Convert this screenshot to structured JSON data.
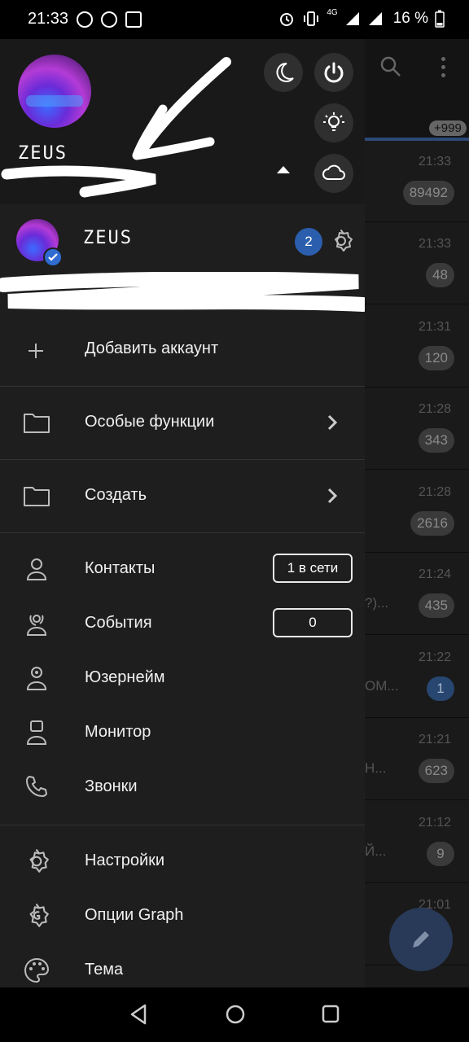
{
  "status_bar": {
    "time": "21:33",
    "network": "4G",
    "battery": "16 %"
  },
  "background_chats": {
    "badge_top": "+999",
    "rows": [
      {
        "time": "21:33",
        "count": "89492",
        "snippet": "",
        "blue": false
      },
      {
        "time": "21:33",
        "count": "48",
        "snippet": "",
        "blue": false
      },
      {
        "time": "21:31",
        "count": "120",
        "snippet": "",
        "blue": false
      },
      {
        "time": "21:28",
        "count": "343",
        "snippet": "",
        "blue": false
      },
      {
        "time": "21:28",
        "count": "2616",
        "snippet": "",
        "blue": false
      },
      {
        "time": "21:24",
        "count": "435",
        "snippet": "?)...",
        "blue": false
      },
      {
        "time": "21:22",
        "count": "1",
        "snippet": "OM...",
        "blue": true
      },
      {
        "time": "21:21",
        "count": "623",
        "snippet": "H...",
        "blue": false
      },
      {
        "time": "21:12",
        "count": "9",
        "snippet": "Й...",
        "blue": false
      },
      {
        "time": "21:01",
        "count": "",
        "snippet": "",
        "blue": false
      }
    ]
  },
  "drawer": {
    "header_name": "ZEUS",
    "account": {
      "name": "ZEUS",
      "badge": "2"
    },
    "add_account": "Добавить аккаунт",
    "special_features": "Особые функции",
    "create": "Создать",
    "contacts": {
      "label": "Контакты",
      "pill": "1 в сети"
    },
    "events": {
      "label": "События",
      "pill": "0"
    },
    "username": "Юзернейм",
    "monitor": "Монитор",
    "calls": "Звонки",
    "settings": "Настройки",
    "graph_options": "Опции Graph",
    "theme": "Тема"
  },
  "colors": {
    "drawer_bg": "#1e1e1e",
    "header_bg": "#191919",
    "accent_blue": "#2b5fad"
  }
}
